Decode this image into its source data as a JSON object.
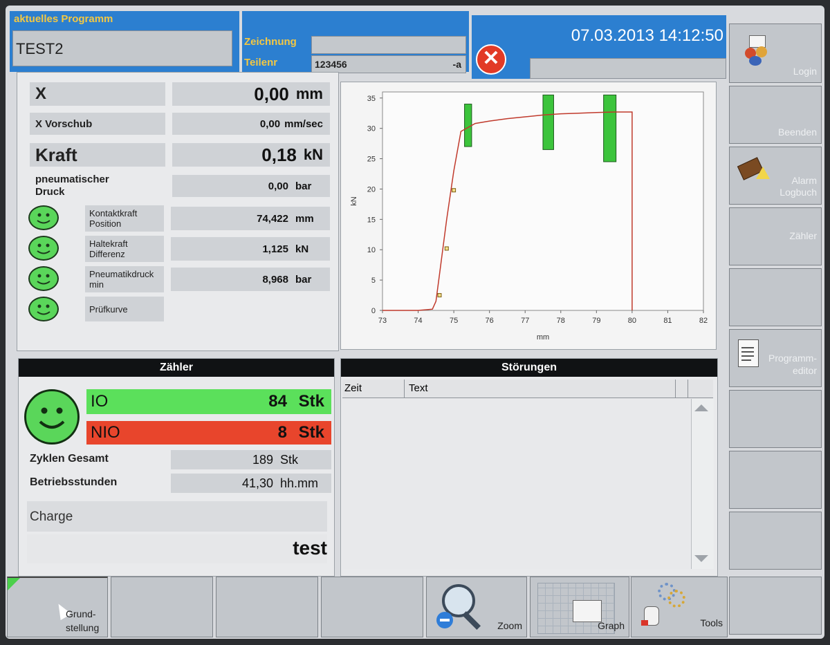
{
  "header": {
    "program_label": "aktuelles Programm",
    "program_value": "TEST2",
    "zeichnung_label": "Zeichnung",
    "zeichnung_value": "",
    "teilenr_label": "Teilenr",
    "teilenr_value": "123456",
    "teilenr_suffix": "-a",
    "datetime": "07.03.2013 14:12:50",
    "status_value": ""
  },
  "measurements": [
    {
      "label": "X",
      "value": "0,00",
      "unit": "mm"
    },
    {
      "label": "X Vorschub",
      "value": "0,00",
      "unit": "mm/sec"
    },
    {
      "label": "Kraft",
      "value": "0,18",
      "unit": "kN"
    },
    {
      "label": "pneumatischer Druck",
      "value": "0,00",
      "unit": "bar"
    }
  ],
  "checks": [
    {
      "label": "Kontaktkraft Position",
      "value": "74,422",
      "unit": "mm"
    },
    {
      "label": "Haltekraft Differenz",
      "value": "1,125",
      "unit": "kN"
    },
    {
      "label": "Pneumatikdruck min",
      "value": "8,968",
      "unit": "bar"
    },
    {
      "label": "Prüfkurve",
      "value": "",
      "unit": ""
    }
  ],
  "counter": {
    "title": "Zähler",
    "io_label": "IO",
    "io_value": "84",
    "io_unit": "Stk",
    "nio_label": "NIO",
    "nio_value": "8",
    "nio_unit": "Stk",
    "cycles_label": "Zyklen Gesamt",
    "cycles_value": "189",
    "cycles_unit": "Stk",
    "hours_label": "Betriebsstunden",
    "hours_value": "41,30",
    "hours_unit": "hh.mm",
    "charge_label": "Charge",
    "charge_value": "test",
    "colors": {
      "io": "#5be05b",
      "nio": "#e8452c"
    }
  },
  "faults": {
    "title": "Störungen",
    "col_time": "Zeit",
    "col_text": "Text",
    "rows": []
  },
  "sidebar": [
    {
      "label": "Login",
      "icon": "login-icon"
    },
    {
      "label": "Beenden",
      "icon": ""
    },
    {
      "label": "Alarm Logbuch",
      "icon": "alarm-log-icon"
    },
    {
      "label": "Zähler",
      "icon": ""
    },
    {
      "label": "",
      "icon": ""
    },
    {
      "label": "Programm-editor",
      "icon": "program-editor-icon"
    },
    {
      "label": "",
      "icon": ""
    },
    {
      "label": "",
      "icon": ""
    },
    {
      "label": "",
      "icon": ""
    }
  ],
  "bottom": [
    {
      "label": "Grund-stellung",
      "icon": "cursor-icon"
    },
    {
      "label": "",
      "icon": ""
    },
    {
      "label": "",
      "icon": ""
    },
    {
      "label": "",
      "icon": ""
    },
    {
      "label": "Zoom",
      "icon": "zoom-icon"
    },
    {
      "label": "Graph",
      "icon": "graph-icon"
    },
    {
      "label": "Tools",
      "icon": "tools-icon"
    },
    {
      "label": "",
      "icon": ""
    }
  ],
  "chart_data": {
    "type": "line",
    "xlabel": "mm",
    "ylabel": "kN",
    "xlim": [
      73,
      82
    ],
    "ylim": [
      0,
      36
    ],
    "xticks": [
      73,
      74,
      75,
      76,
      77,
      78,
      79,
      80,
      81,
      82
    ],
    "yticks": [
      0,
      5,
      10,
      15,
      20,
      25,
      30,
      35
    ],
    "grid": false,
    "line_color": "#c0392b",
    "series": [
      {
        "x": [
          73.0,
          74.0,
          74.4,
          74.5,
          74.6,
          74.8,
          75.0,
          75.2,
          75.6,
          76.0,
          76.5,
          77.0,
          77.5,
          78.0,
          78.5,
          79.0,
          79.5,
          80.0,
          80.0
        ],
        "y": [
          0.0,
          0.0,
          0.2,
          1.5,
          6.0,
          15.0,
          23.0,
          29.5,
          30.8,
          31.2,
          31.6,
          31.9,
          32.2,
          32.4,
          32.5,
          32.6,
          32.7,
          32.7,
          0.0
        ]
      }
    ],
    "markers": [
      {
        "x": 74.6,
        "y": 2.5
      },
      {
        "x": 74.8,
        "y": 10.2
      },
      {
        "x": 75.0,
        "y": 19.8
      }
    ],
    "windows": [
      {
        "x_min": 75.3,
        "x_max": 75.5,
        "y_min": 27.0,
        "y_max": 34.0
      },
      {
        "x_min": 77.5,
        "x_max": 77.8,
        "y_min": 26.5,
        "y_max": 35.5
      },
      {
        "x_min": 79.2,
        "x_max": 79.55,
        "y_min": 24.5,
        "y_max": 35.5
      }
    ],
    "window_color": "#3cc43c"
  }
}
